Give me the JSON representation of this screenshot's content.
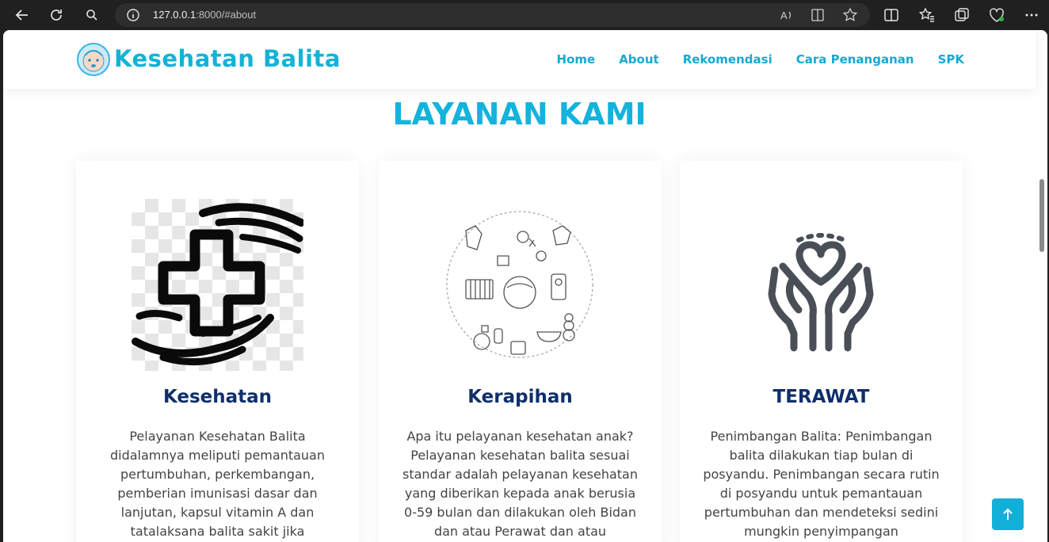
{
  "browser": {
    "url_host": "127.0.0.1",
    "url_rest": ":8000/#about"
  },
  "header": {
    "brand": "Kesehatan Balita",
    "menu": [
      "Home",
      "About",
      "Rekomendasi",
      "Cara Penanganan",
      "SPK"
    ]
  },
  "section": {
    "title": "LAYANAN KAMI"
  },
  "cards": [
    {
      "title": "Kesehatan",
      "text": "Pelayanan Kesehatan Balita didalamnya meliputi pemantauan pertumbuhan, perkembangan, pemberian imunisasi dasar dan lanjutan, kapsul vitamin A dan tatalaksana balita sakit jika diperlukan.",
      "icon": "hands-medical-cross-icon"
    },
    {
      "title": "Kerapihan",
      "text": "Apa itu pelayanan kesehatan anak? Pelayanan kesehatan balita sesuai standar adalah pelayanan kesehatan yang diberikan kepada anak berusia 0-59 bulan dan dilakukan oleh Bidan dan atau Perawat dan atau Dokter/DLP dan",
      "icon": "baby-items-circle-icon"
    },
    {
      "title": "TERAWAT",
      "text": "Penimbangan Balita: Penimbangan balita dilakukan tiap bulan di posyandu. Penimbangan secara rutin di posyandu untuk pemantauan pertumbuhan dan mendeteksi sedini mungkin penyimpangan pertumbuhan",
      "icon": "hands-heart-icon"
    }
  ],
  "colors": {
    "accent": "#13b3dc",
    "card_title": "#0f2f6b"
  }
}
